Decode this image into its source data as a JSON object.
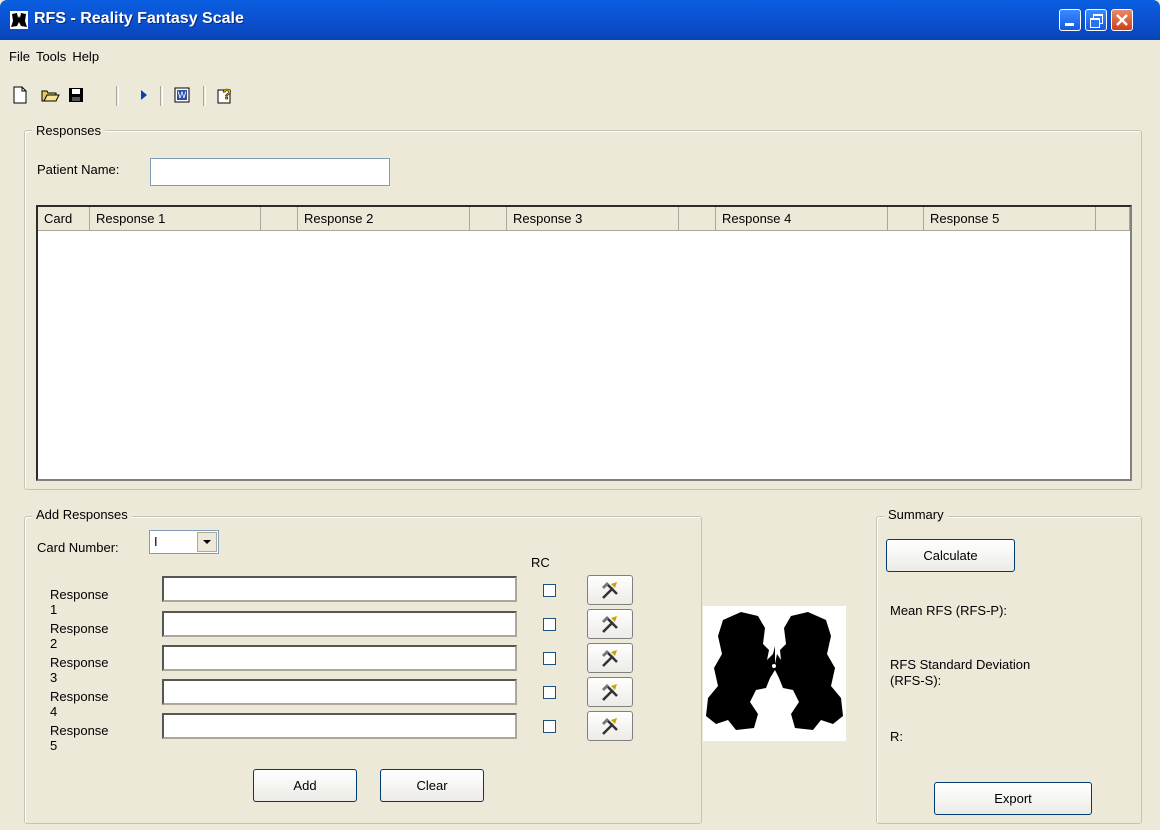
{
  "window": {
    "title": "RFS - Reality Fantasy Scale"
  },
  "menu": [
    "File",
    "Tools",
    "Help"
  ],
  "toolbar_icons": [
    "new-file-icon",
    "open-folder-icon",
    "save-icon",
    "run-icon",
    "word-export-icon",
    "help-icon"
  ],
  "responses_group": {
    "legend": "Responses",
    "patient_label": "Patient Name:",
    "patient_value": "",
    "columns": [
      "Card",
      "Response 1",
      "",
      "Response 2",
      "",
      "Response 3",
      "",
      "Response 4",
      "",
      "Response 5",
      ""
    ]
  },
  "add_group": {
    "legend": "Add Responses",
    "card_label": "Card Number:",
    "card_value": "I",
    "rc_label": "RC",
    "rows": [
      {
        "label": "Response 1",
        "value": ""
      },
      {
        "label": "Response 2",
        "value": ""
      },
      {
        "label": "Response 3",
        "value": ""
      },
      {
        "label": "Response 4",
        "value": ""
      },
      {
        "label": "Response 5",
        "value": ""
      }
    ],
    "add_label": "Add",
    "clear_label": "Clear"
  },
  "summary": {
    "legend": "Summary",
    "calculate_label": "Calculate",
    "mean_label": "Mean RFS (RFS-P):",
    "sd_label_line1": "RFS Standard Deviation",
    "sd_label_line2": "(RFS-S):",
    "r_label": "R:",
    "export_label": "Export"
  },
  "colors": {
    "accent": "#0a5fe0",
    "background": "#ece9d8"
  }
}
